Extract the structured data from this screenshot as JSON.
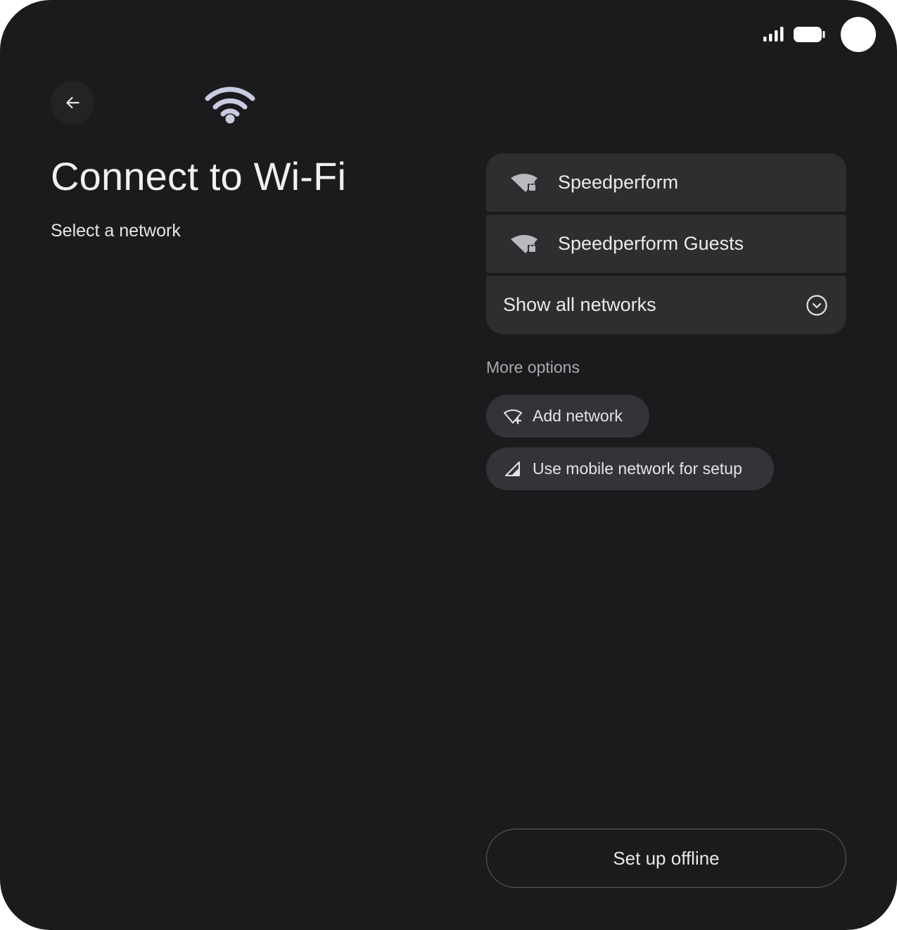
{
  "status_bar": {
    "icons": [
      "cellular-signal-icon",
      "battery-icon",
      "camera-cutout"
    ]
  },
  "header": {
    "back_icon": "arrow-back-icon",
    "hero_icon": "wifi-icon",
    "title": "Connect to Wi-Fi",
    "subtitle": "Select a network"
  },
  "networks": [
    {
      "name": "Speedperform",
      "icon": "wifi-lock-icon"
    },
    {
      "name": "Speedperform Guests",
      "icon": "wifi-lock-icon"
    }
  ],
  "show_all": {
    "label": "Show all networks",
    "icon": "chevron-down-circle-icon"
  },
  "more_options": {
    "heading": "More options",
    "add_network": {
      "label": "Add network",
      "icon": "wifi-add-icon"
    },
    "mobile_network": {
      "label": "Use mobile network for setup",
      "icon": "cellular-icon"
    }
  },
  "footer": {
    "offline_label": "Set up offline"
  },
  "colors": {
    "background": "#1b1b1d",
    "surface": "#2d2e30",
    "chip": "#333437",
    "text_primary": "#f1f1f3",
    "text_secondary": "#a9aaae",
    "hero_icon": "#c9cbe0"
  }
}
